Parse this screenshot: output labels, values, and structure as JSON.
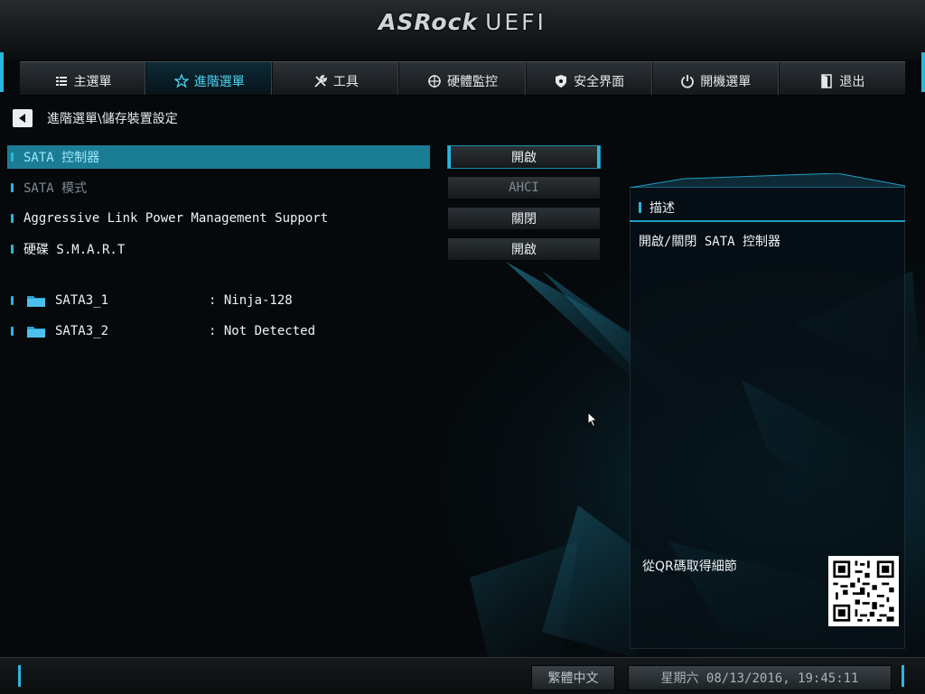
{
  "brand": {
    "name": "ASRock",
    "product": "UEFI"
  },
  "tabs": [
    {
      "label": "主選單",
      "icon": "list-icon",
      "active": false
    },
    {
      "label": "進階選單",
      "icon": "star-icon",
      "active": true
    },
    {
      "label": "工具",
      "icon": "tools-icon",
      "active": false
    },
    {
      "label": "硬體監控",
      "icon": "monitor-target-icon",
      "active": false
    },
    {
      "label": "安全界面",
      "icon": "shield-icon",
      "active": false
    },
    {
      "label": "開機選單",
      "icon": "power-icon",
      "active": false
    },
    {
      "label": "退出",
      "icon": "exit-door-icon",
      "active": false
    }
  ],
  "breadcrumb": "進階選單\\儲存裝置設定",
  "settings": [
    {
      "label": "SATA 控制器",
      "value": "開啟",
      "selected": true,
      "disabled": false
    },
    {
      "label": "SATA 模式",
      "value": "AHCI",
      "selected": false,
      "disabled": true
    },
    {
      "label": "Aggressive Link Power Management Support",
      "value": "關閉",
      "selected": false,
      "disabled": false
    },
    {
      "label": "硬碟 S.M.A.R.T",
      "value": "開啟",
      "selected": false,
      "disabled": false
    }
  ],
  "drives": [
    {
      "name": "SATA3_1",
      "value": ": Ninja-128"
    },
    {
      "name": "SATA3_2",
      "value": ": Not Detected"
    }
  ],
  "description": {
    "title": "描述",
    "text": "開啟/關閉 SATA 控制器",
    "qr_label": "從QR碼取得細節"
  },
  "footer": {
    "language": "繁體中文",
    "datetime": "星期六 08/13/2016, 19:45:11"
  },
  "colors": {
    "accent": "#2bb6dd",
    "selected_row": "#1b7d94",
    "background": "#05090c"
  }
}
